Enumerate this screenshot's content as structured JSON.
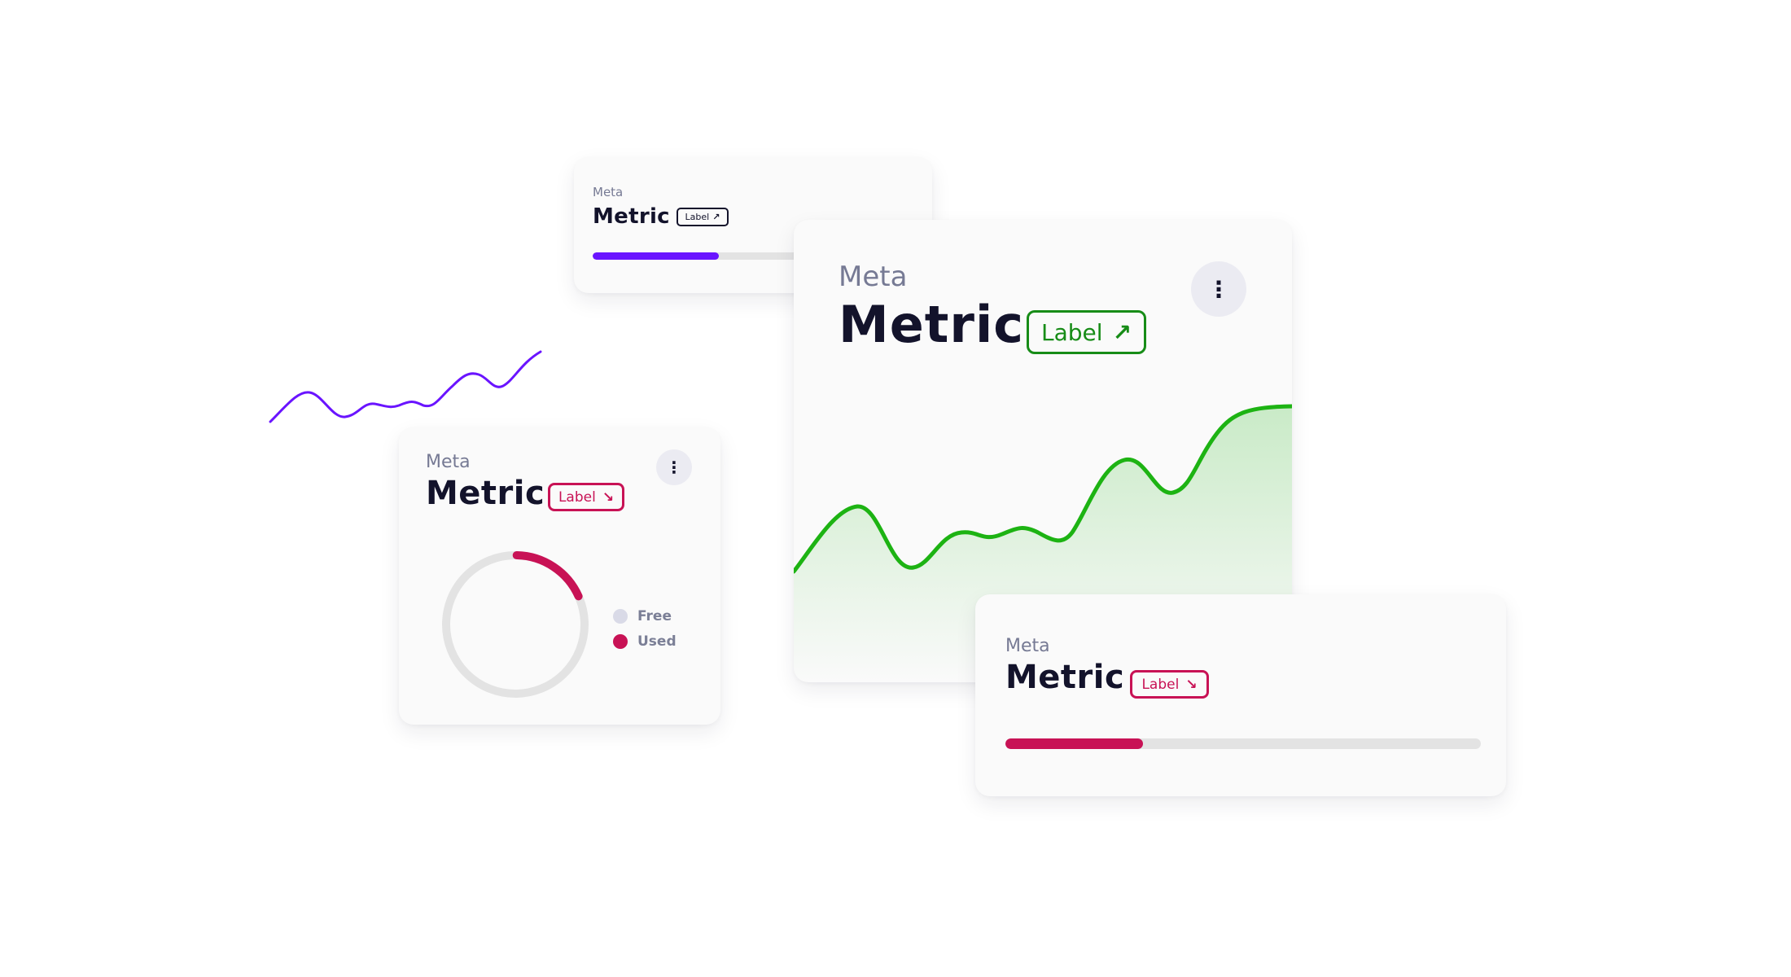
{
  "colors": {
    "purple": "#6a14ff",
    "green": "#1db313",
    "green_badge": "#178c17",
    "crimson": "#c81255",
    "track": "#e3e3e3",
    "free_dot": "#d9dae7",
    "text_dark": "#13132b",
    "text_meta": "#767a94"
  },
  "icons": {
    "arrow_up_right": "↗",
    "arrow_down_right": "↘",
    "menu": "⋮"
  },
  "card_top": {
    "meta": "Meta",
    "metric": "Metric",
    "badge": "Label",
    "progress": 0.42
  },
  "card_main": {
    "meta": "Meta",
    "metric": "Metric",
    "badge": "Label"
  },
  "card_donut": {
    "meta": "Meta",
    "metric": "Metric",
    "badge": "Label",
    "used_fraction": 0.18,
    "legend": [
      {
        "label": "Free"
      },
      {
        "label": "Used"
      }
    ]
  },
  "card_bottom": {
    "meta": "Meta",
    "metric": "Metric",
    "badge": "Label",
    "progress": 0.29
  }
}
